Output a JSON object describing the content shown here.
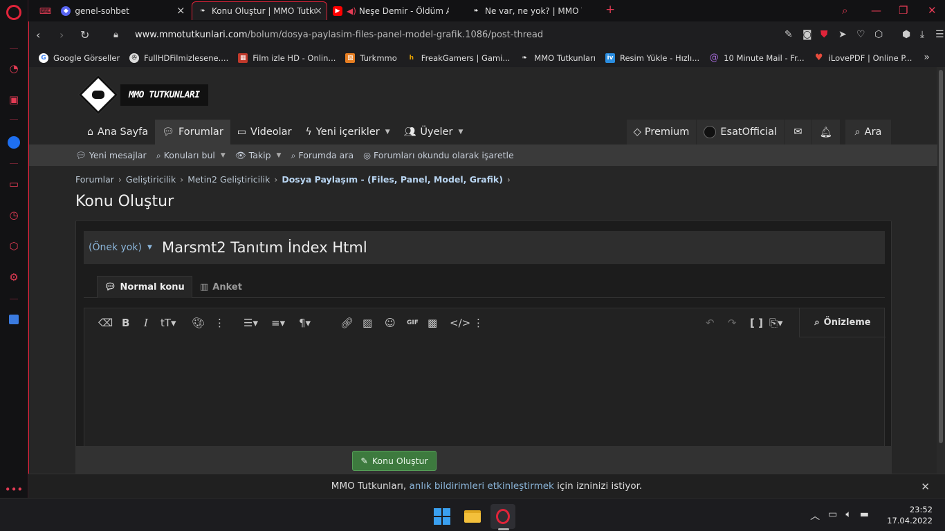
{
  "browser": {
    "tabs": [
      {
        "label": "genel-sohbet",
        "fav_color": "#5865f2"
      },
      {
        "label": "Konu Oluştur | MMO Tutku",
        "fav_color": "#222"
      },
      {
        "label": "Neşe Demir - Öldüm Ar",
        "fav_color": "#ff0000"
      },
      {
        "label": "Ne var, ne yok? | MMO Tut",
        "fav_color": "#222"
      }
    ],
    "url_host": "www.mmotutkunlari.com",
    "url_path": "/bolum/dosya-paylasim-files-panel-model-grafik.1086/post-thread",
    "bookmarks": [
      {
        "label": "Google Görseller",
        "color": "#fff"
      },
      {
        "label": "FullHDFilmizlesene....",
        "color": "#ddd"
      },
      {
        "label": "Film izle HD - Onlin...",
        "color": "#c0392b"
      },
      {
        "label": "Turkmmo",
        "color": "#e67e22"
      },
      {
        "label": "FreakGamers | Gami...",
        "color": "#e6a100"
      },
      {
        "label": "MMO Tutkunları",
        "color": "#222"
      },
      {
        "label": "Resim Yükle - Hızlı...",
        "color": "#2a8de0"
      },
      {
        "label": "10 Minute Mail - Fr...",
        "color": "#8e44ad"
      },
      {
        "label": "iLovePDF | Online P...",
        "color": "#e74c3c"
      }
    ]
  },
  "site": {
    "logo_text": "MMO TUTKUNLARI",
    "nav": [
      {
        "label": "Ana Sayfa"
      },
      {
        "label": "Forumlar"
      },
      {
        "label": "Videolar"
      },
      {
        "label": "Yeni içerikler"
      },
      {
        "label": "Üyeler"
      }
    ],
    "user_nav": {
      "premium": "Premium",
      "username": "EsatOfficial",
      "search": "Ara"
    },
    "subnav": [
      {
        "label": "Yeni mesajlar"
      },
      {
        "label": "Konuları bul"
      },
      {
        "label": "Takip"
      },
      {
        "label": "Forumda ara"
      },
      {
        "label": "Forumları okundu olarak işaretle"
      }
    ],
    "breadcrumbs": [
      "Forumlar",
      "Geliştiricilik",
      "Metin2 Geliştiricilik",
      "Dosya Paylaşım - (Files, Panel, Model, Grafik)"
    ],
    "page_title": "Konu Oluştur"
  },
  "editor": {
    "prefix": "(Önek yok)",
    "title_value": "Marsmt2 Tanıtım İndex Html",
    "tabs": [
      {
        "label": "Normal konu"
      },
      {
        "label": "Anket"
      }
    ],
    "preview_label": "Önizleme",
    "submit_label": "Konu Oluştur"
  },
  "notification": {
    "prefix": "MMO Tutkunları,",
    "link": "anlık bildirimleri etkinleştirmek",
    "suffix": "için izninizi istiyor."
  },
  "taskbar": {
    "time": "23:52",
    "date": "17.04.2022"
  }
}
